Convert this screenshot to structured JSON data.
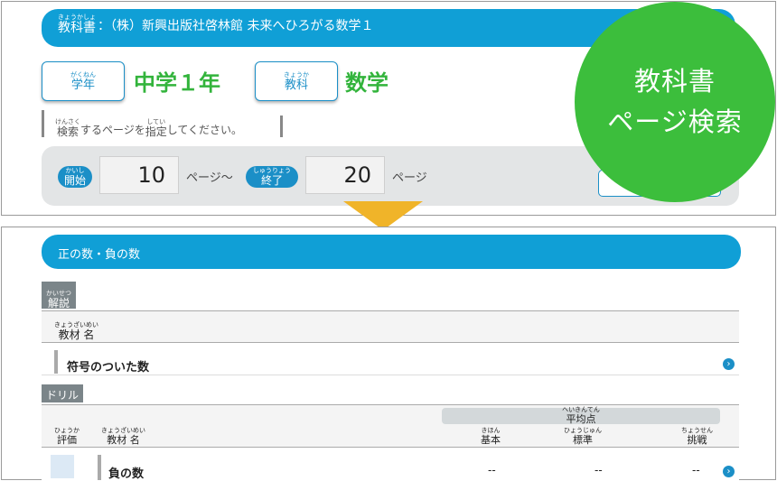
{
  "top": {
    "textbook_label": "教科書",
    "textbook_label_ruby": "きょうかしょ",
    "textbook_name": "：（株）新興出版社啓林館 未来へひろがる数学１",
    "grade_button": "学年",
    "grade_button_ruby": "がくねん",
    "grade_value": "中学１年",
    "subject_button": "教科",
    "subject_button_ruby": "きょうか",
    "subject_value": "数学",
    "hint_kanji1": "検索",
    "hint_kanji1_ruby": "けんさく",
    "hint_mid": "するページを",
    "hint_kanji2": "指定",
    "hint_kanji2_ruby": "してい",
    "hint_end": "してください。",
    "start_label": "開始",
    "start_ruby": "かいし",
    "start_value": "10",
    "page_tilde": "ページ～",
    "end_label": "終了",
    "end_ruby": "しゅうりょう",
    "end_value": "20",
    "page_suffix": "ページ"
  },
  "badge": {
    "line1": "教科書",
    "line2": "ページ検索"
  },
  "bottom": {
    "unit_title": "正の数・負の数",
    "kaisetsu_tab": "解説",
    "kaisetsu_ruby": "かいせつ",
    "material_label": "教材 名",
    "material_ruby": "きょうざいめい",
    "kaisetsu_item": "符号のついた数",
    "drill_tab": "ドリル",
    "avg_label": "平均点",
    "avg_ruby": "へいきんてん",
    "eval_label": "評価",
    "eval_ruby": "ひょうか",
    "basic_label": "基本",
    "basic_ruby": "きほん",
    "standard_label": "標準",
    "standard_ruby": "ひょうじゅん",
    "challenge_label": "挑戦",
    "challenge_ruby": "ちょうせん",
    "drill_item": "負の数",
    "basic_score": "--",
    "standard_score": "--",
    "challenge_score": "--"
  },
  "colors": {
    "accent_blue": "#109fd6",
    "accent_green": "#3cbe3c",
    "arrow_orange": "#f0b429"
  },
  "icons": {
    "open_link": "circled-right-arrow"
  }
}
